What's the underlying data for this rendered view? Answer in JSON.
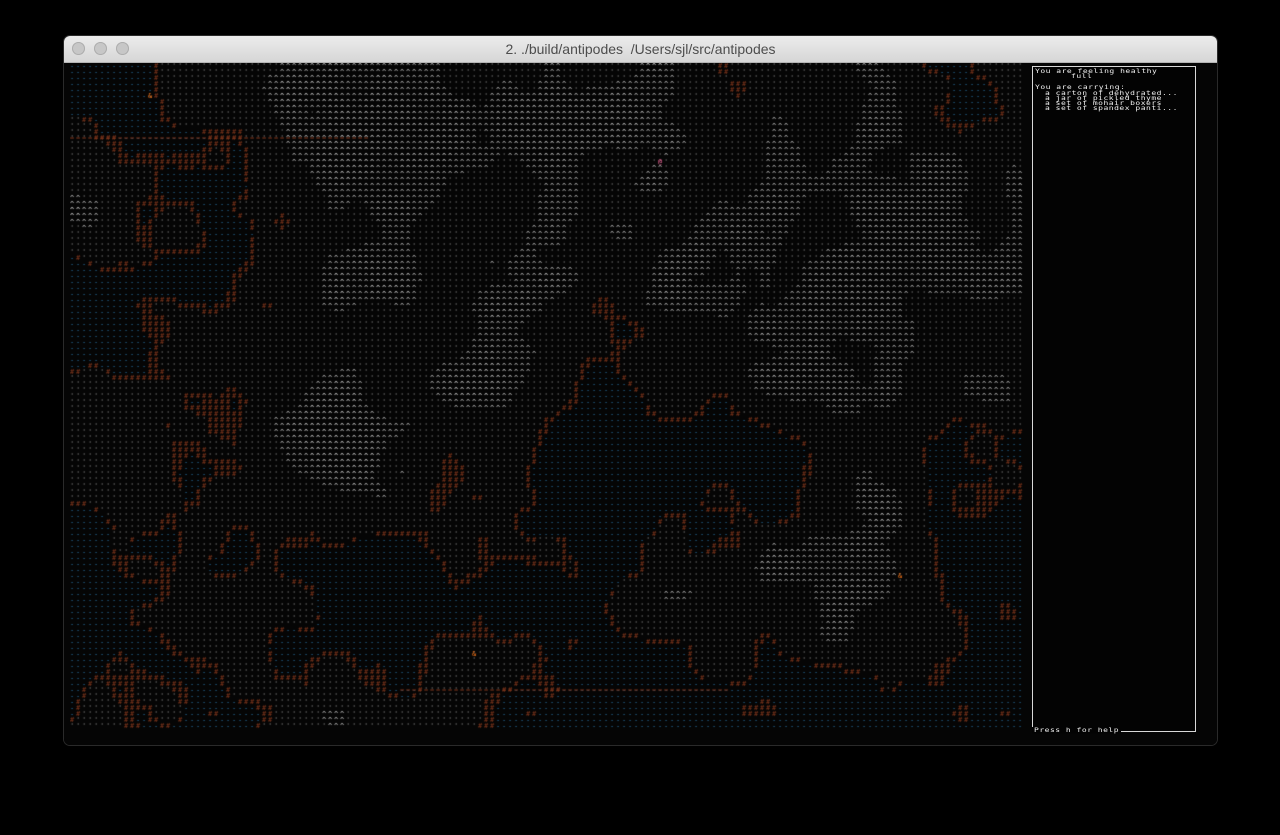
{
  "window": {
    "title": "2. ./build/antipodes  /Users/sjl/src/antipodes"
  },
  "status": {
    "health": "You are feeling healthy",
    "fullness": "full",
    "carrying_heading": "You are carrying:",
    "inventory": [
      "a carton of dehydrated...",
      "a jar of pickled thyme",
      "a set of mohair boxers",
      "a set of spandex panti..."
    ]
  },
  "help_hint": "Press h for help",
  "map": {
    "colors": {
      "water": "#2f86c0",
      "land": "#8a8a8a",
      "road": "#8a3a1e",
      "snow": "#f0f0f0",
      "mountain": "#d8d8d8",
      "item": "#ff7a1a",
      "creature": "#ff6aa0"
    }
  }
}
